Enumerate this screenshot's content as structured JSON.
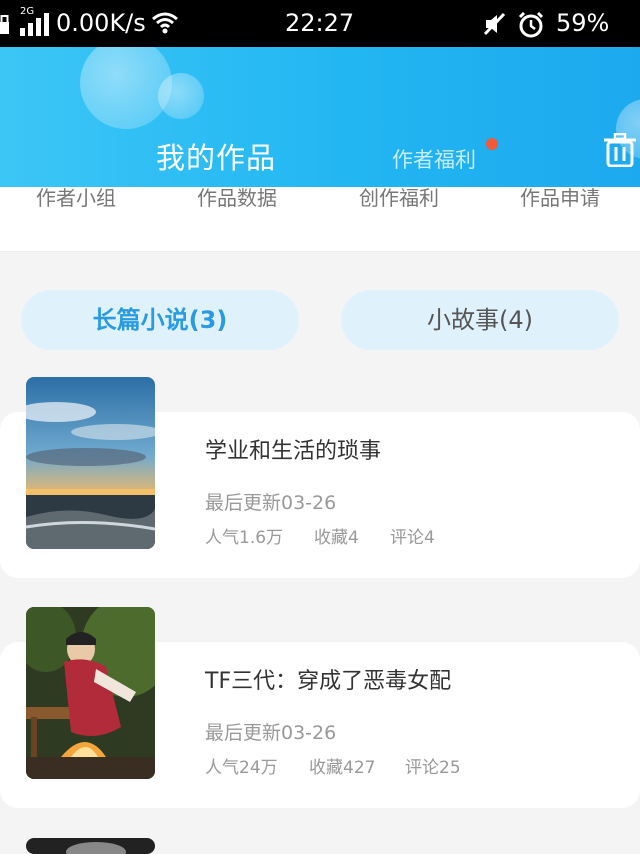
{
  "status_bar": {
    "network_type": "2G",
    "speed": "0.00K/s",
    "time": "22:27",
    "battery": "59%"
  },
  "header": {
    "title": "我的作品",
    "tab_label": "作者福利",
    "has_notification_dot": true,
    "accent_color": "#22b6f2"
  },
  "quick_menu": [
    {
      "label": "作者小组"
    },
    {
      "label": "作品数据"
    },
    {
      "label": "创作福利"
    },
    {
      "label": "作品申请"
    }
  ],
  "segments": [
    {
      "label": "长篇小说(3)",
      "active": true
    },
    {
      "label": "小故事(4)",
      "active": false
    }
  ],
  "works": [
    {
      "title": "学业和生活的琐事",
      "updated": "最后更新03-26",
      "popularity": "人气1.6万",
      "favorites": "收藏4",
      "comments": "评论4"
    },
    {
      "title": "TF三代：穿成了恶毒女配",
      "updated": "最后更新03-26",
      "popularity": "人气24万",
      "favorites": "收藏427",
      "comments": "评论25"
    }
  ]
}
